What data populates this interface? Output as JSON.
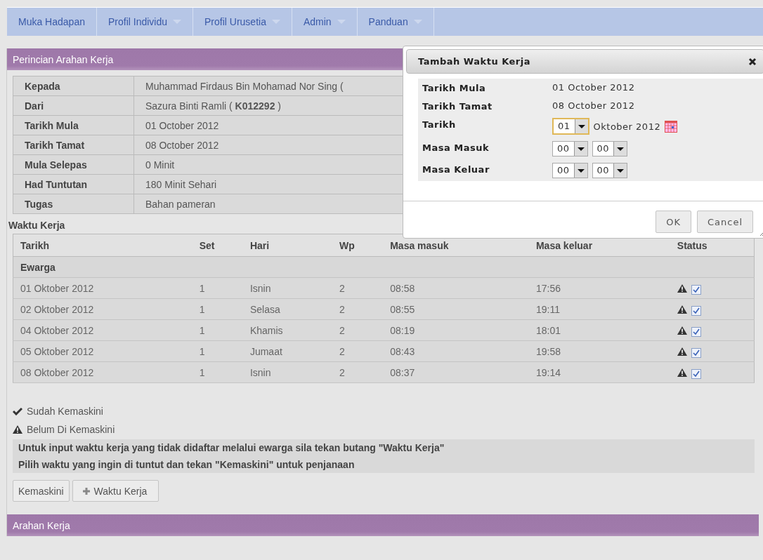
{
  "nav": [
    {
      "label": "Muka Hadapan",
      "dropdown": false
    },
    {
      "label": "Profil Individu",
      "dropdown": true
    },
    {
      "label": "Profil Urusetia",
      "dropdown": true
    },
    {
      "label": "Admin",
      "dropdown": true
    },
    {
      "label": "Panduan",
      "dropdown": true
    }
  ],
  "panel_title": "Perincian Arahan Kerja",
  "details": [
    {
      "label": "Kepada",
      "value": "Muhammad Firdaus Bin Mohamad Nor Sing ("
    },
    {
      "label": "Dari",
      "value": "Sazura Binti Ramli ( **K012292** )"
    },
    {
      "label": "Tarikh Mula",
      "value": "01 October 2012"
    },
    {
      "label": "Tarikh Tamat",
      "value": "08 October 2012"
    },
    {
      "label": "Mula Selepas",
      "value": "0 Minit"
    },
    {
      "label": "Had Tuntutan",
      "value": "180 Minit Sehari"
    },
    {
      "label": "Tugas",
      "value": "Bahan pameran"
    }
  ],
  "section_title": "Waktu Kerja",
  "table": {
    "columns": [
      "Tarikh",
      "Set",
      "Hari",
      "Wp",
      "Masa masuk",
      "Masa keluar",
      "Status"
    ],
    "group": "Ewarga",
    "rows": [
      {
        "cells": [
          "01 Oktober 2012",
          "1",
          "Isnin",
          "2",
          "08:58",
          "17:56"
        ],
        "checked": true
      },
      {
        "cells": [
          "02 Oktober 2012",
          "1",
          "Selasa",
          "2",
          "08:55",
          "19:11"
        ],
        "checked": true
      },
      {
        "cells": [
          "04 Oktober 2012",
          "1",
          "Khamis",
          "2",
          "08:19",
          "18:01"
        ],
        "checked": true
      },
      {
        "cells": [
          "05 Oktober 2012",
          "1",
          "Jumaat",
          "2",
          "08:43",
          "19:58"
        ],
        "checked": true
      },
      {
        "cells": [
          "08 Oktober 2012",
          "1",
          "Isnin",
          "2",
          "08:37",
          "19:14"
        ],
        "checked": true
      }
    ]
  },
  "legend": [
    {
      "kind": "check",
      "label": "Sudah Kemaskini"
    },
    {
      "kind": "warning",
      "label": "Belum Di Kemaskini"
    }
  ],
  "notes": [
    "Untuk input waktu kerja yang tidak didaftar melalui ewarga sila tekan butang \"Waktu Kerja\"",
    "Pilih waktu yang ingin di tuntut dan tekan \"Kemaskini\" untuk penjanaan"
  ],
  "buttons": [
    {
      "label": "Kemaskini",
      "kind": "plain"
    },
    {
      "label": "Waktu Kerja",
      "kind": "add"
    }
  ],
  "bottom_panel_title": "Arahan Kerja",
  "dialog": {
    "title": "Tambah Waktu Kerja",
    "fields": [
      {
        "label": "Tarikh Mula",
        "kind": "text",
        "value": "01 October 2012"
      },
      {
        "label": "Tarikh Tamat",
        "kind": "text",
        "value": "08 October 2012"
      },
      {
        "label": "Tarikh",
        "kind": "date",
        "selects": [
          {
            "value": "01",
            "focused": true
          }
        ],
        "suffix": "Oktober 2012"
      },
      {
        "label": "Masa Masuk",
        "kind": "time",
        "selects": [
          {
            "value": "00",
            "focused": false
          },
          {
            "value": "00",
            "focused": false
          }
        ]
      },
      {
        "label": "Masa Keluar",
        "kind": "time",
        "selects": [
          {
            "value": "00",
            "focused": false
          },
          {
            "value": "00",
            "focused": false
          }
        ]
      }
    ],
    "buttons": [
      "OK",
      "Cancel"
    ]
  }
}
